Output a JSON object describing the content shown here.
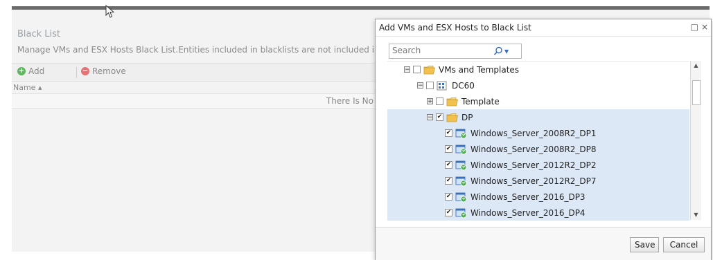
{
  "background": {
    "title": "Black List",
    "description": "Manage VMs and ESX Hosts Black List.Entities included in blacklists are not included in the",
    "toolbar": {
      "add_label": "Add",
      "remove_label": "Remove"
    },
    "table": {
      "column_name": "Name ▴",
      "empty_text": "There Is No"
    }
  },
  "dialog": {
    "title": "Add VMs and ESX Hosts to Black List",
    "controls": {
      "maximize": "□",
      "close": "×"
    },
    "search": {
      "placeholder": "Search",
      "value": ""
    },
    "tree": [
      {
        "label": "VMs and Templates",
        "indent": 0,
        "expander": "−",
        "checked": false,
        "icon": "folder-icon",
        "selected": false
      },
      {
        "label": "DC60",
        "indent": 1,
        "expander": "−",
        "checked": false,
        "icon": "datacenter-icon",
        "selected": false
      },
      {
        "label": "Template",
        "indent": 2,
        "expander": "+",
        "checked": false,
        "icon": "folder-icon",
        "selected": false
      },
      {
        "label": "DP",
        "indent": 2,
        "expander": "−",
        "checked": true,
        "icon": "folder-icon",
        "selected": true
      },
      {
        "label": "Windows_Server_2008R2_DP1",
        "indent": 3,
        "expander": "",
        "checked": true,
        "icon": "vm-icon",
        "selected": true
      },
      {
        "label": "Windows_Server_2008R2_DP8",
        "indent": 3,
        "expander": "",
        "checked": true,
        "icon": "vm-icon",
        "selected": true
      },
      {
        "label": "Windows_Server_2012R2_DP2",
        "indent": 3,
        "expander": "",
        "checked": true,
        "icon": "vm-icon",
        "selected": true
      },
      {
        "label": "Windows_Server_2012R2_DP7",
        "indent": 3,
        "expander": "",
        "checked": true,
        "icon": "vm-icon",
        "selected": true
      },
      {
        "label": "Windows_Server_2016_DP3",
        "indent": 3,
        "expander": "",
        "checked": true,
        "icon": "vm-icon",
        "selected": true
      },
      {
        "label": "Windows_Server_2016_DP4",
        "indent": 3,
        "expander": "",
        "checked": true,
        "icon": "vm-icon",
        "selected": true
      }
    ],
    "buttons": {
      "save": "Save",
      "cancel": "Cancel"
    }
  },
  "colors": {
    "selection": "#dde8f7",
    "add": "#5cb85c",
    "remove": "#e57373",
    "folder": "#f2c14e"
  }
}
